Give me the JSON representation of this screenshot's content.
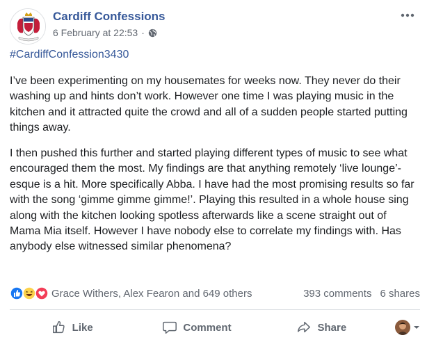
{
  "post": {
    "page_name": "Cardiff Confessions",
    "timestamp": "6 February at 22:53",
    "separator": "·",
    "hashtag": "#CardiffConfession3430",
    "paragraphs": [
      "I’ve been experimenting on my housemates for weeks now. They never do their washing up and hints don’t work. However one time I was playing music in the kitchen and it attracted quite the crowd and all of a sudden people started putting things away.",
      "I then pushed this further and started playing different types of music to see what encouraged them the most. My findings are that anything remotely ‘live lounge’-esque is a hit. More specifically Abba. I have had the most promising results so far with the song ‘gimme gimme gimme!’. Playing this resulted in a whole house sing along with the kitchen looking spotless afterwards like a scene straight out of Mama Mia itself. However I have nobody else to correlate my findings with. Has anybody else witnessed similar phenomena?"
    ]
  },
  "reactions": {
    "icons": [
      "like-icon",
      "haha-icon",
      "love-icon"
    ],
    "reactors_text": "Grace Withers, Alex Fearon and 649 others",
    "comments_text": "393 comments",
    "shares_text": "6 shares"
  },
  "actions": {
    "like_label": "Like",
    "comment_label": "Comment",
    "share_label": "Share"
  },
  "colors": {
    "link_blue": "#365899",
    "like_blue": "#1877f2",
    "love_red": "#f33e58",
    "haha_yellow": "#fcd34d",
    "muted_gray": "#616770"
  }
}
